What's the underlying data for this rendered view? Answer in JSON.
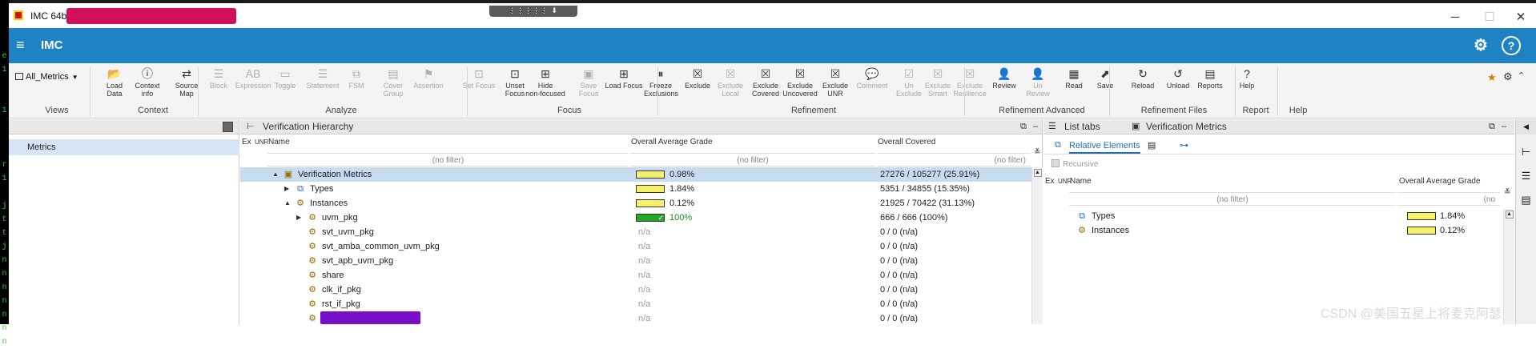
{
  "terminal": {
    "chars": [
      "e",
      "1",
      "",
      "",
      "1",
      "",
      "",
      "",
      "r",
      "1",
      "",
      "j",
      "t",
      "t",
      "j",
      "n",
      "n",
      "n",
      "n",
      "n",
      "n",
      "n"
    ]
  },
  "window": {
    "title": "IMC 64b"
  },
  "app": {
    "name": "IMC",
    "menu_glyph": "≡",
    "settings_glyph": "⚙",
    "help_glyph": "?"
  },
  "window_controls": {
    "minimize": "─",
    "maximize": "☐",
    "close": "✕"
  },
  "grip_label": "⋮⋮⋮⋮⋮ ⬇ ⋮⋮⋮⋮⋮",
  "toolbar": {
    "metrics_combo": "All_Metrics",
    "buttons": [
      {
        "label": "Load\nData",
        "glyph": "📂",
        "enabled": true
      },
      {
        "label": "Context\ninfo",
        "glyph": "ⓘ",
        "enabled": true
      },
      {
        "label": "Source Map",
        "glyph": "⇄",
        "enabled": true
      },
      {
        "label": "Block",
        "glyph": "☰",
        "enabled": false
      },
      {
        "label": "Expression",
        "glyph": "AB",
        "enabled": false
      },
      {
        "label": "Toggle",
        "glyph": "▭",
        "enabled": false
      },
      {
        "label": "Statement",
        "glyph": "☰",
        "enabled": false
      },
      {
        "label": "FSM",
        "glyph": "⧉",
        "enabled": false
      },
      {
        "label": "Cover\nGroup",
        "glyph": "▤",
        "enabled": false
      },
      {
        "label": "Assertion",
        "glyph": "⚑",
        "enabled": false
      },
      {
        "label": "Set Focus",
        "glyph": "⊡",
        "enabled": false
      },
      {
        "label": "Unset\nFocus",
        "glyph": "⊡",
        "enabled": true
      },
      {
        "label": "Hide\nnon-focused",
        "glyph": "⊞",
        "enabled": true
      },
      {
        "label": "Save Focus",
        "glyph": "▣",
        "enabled": false
      },
      {
        "label": "Load Focus",
        "glyph": "⊞",
        "enabled": true
      },
      {
        "label": "Freeze\nExclusions",
        "glyph": "⏸",
        "enabled": true
      },
      {
        "label": "Exclude",
        "glyph": "☒",
        "enabled": true
      },
      {
        "label": "Exclude\nLocal",
        "glyph": "☒",
        "enabled": false
      },
      {
        "label": "Exclude\nCovered",
        "glyph": "☒",
        "enabled": true
      },
      {
        "label": "Exclude\nUncovered",
        "glyph": "☒",
        "enabled": true
      },
      {
        "label": "Exclude\nUNR",
        "glyph": "☒",
        "enabled": true
      },
      {
        "label": "Comment",
        "glyph": "💬",
        "enabled": false
      },
      {
        "label": "Un\nExclude",
        "glyph": "☑",
        "enabled": false
      },
      {
        "label": "Exclude\nSmart",
        "glyph": "☒",
        "enabled": false
      },
      {
        "label": "Exclude\nResilience",
        "glyph": "☒",
        "enabled": false
      },
      {
        "label": "Review",
        "glyph": "👤",
        "enabled": true
      },
      {
        "label": "Un\nReview",
        "glyph": "👤",
        "enabled": false
      },
      {
        "label": "Read",
        "glyph": "▦",
        "enabled": true
      },
      {
        "label": "Save",
        "glyph": "⬈",
        "enabled": true
      },
      {
        "label": "Reload",
        "glyph": "↻",
        "enabled": true
      },
      {
        "label": "Unload",
        "glyph": "↺",
        "enabled": true
      },
      {
        "label": "Reports",
        "glyph": "▤",
        "enabled": true
      },
      {
        "label": "Help",
        "glyph": "?",
        "enabled": true
      }
    ],
    "groups": [
      "Views",
      "Context",
      "Analyze",
      "Focus",
      "Refinement",
      "Refinement Advanced",
      "Refinement Files",
      "Report",
      "Help"
    ]
  },
  "left_pane": {
    "selected_item": "Metrics"
  },
  "hierarchy": {
    "title": "Verification Hierarchy",
    "columns": {
      "ex": "Ex",
      "unr": "UNR",
      "name": "Name",
      "grade": "Overall Average Grade",
      "covered": "Overall Covered"
    },
    "filter_placeholder": "(no filter)",
    "rows": [
      {
        "name": "Verification Metrics",
        "grade": "0.98%",
        "grade_fraction": 0.0098,
        "covered": "27276 / 105277 (25.91%)",
        "indent": 0,
        "expander": "▲",
        "icon": "▣"
      },
      {
        "name": "Types",
        "grade": "1.84%",
        "grade_fraction": 0.0184,
        "covered": "5351 / 34855 (15.35%)",
        "indent": 1,
        "expander": "▶",
        "icon": "⧉"
      },
      {
        "name": "Instances",
        "grade": "0.12%",
        "grade_fraction": 0.0012,
        "covered": "21925 / 70422 (31.13%)",
        "indent": 1,
        "expander": "▲",
        "icon": "⚙"
      },
      {
        "name": "uvm_pkg",
        "grade": "100%",
        "grade_fraction": 1.0,
        "covered": "666 / 666 (100%)",
        "indent": 2,
        "expander": "▶",
        "icon": "⚙"
      },
      {
        "name": "svt_uvm_pkg",
        "grade": "n/a",
        "grade_fraction": null,
        "covered": "0 / 0 (n/a)",
        "indent": 2,
        "expander": "",
        "icon": "⚙"
      },
      {
        "name": "svt_amba_common_uvm_pkg",
        "grade": "n/a",
        "grade_fraction": null,
        "covered": "0 / 0 (n/a)",
        "indent": 2,
        "expander": "",
        "icon": "⚙"
      },
      {
        "name": "svt_apb_uvm_pkg",
        "grade": "n/a",
        "grade_fraction": null,
        "covered": "0 / 0 (n/a)",
        "indent": 2,
        "expander": "",
        "icon": "⚙"
      },
      {
        "name": "share",
        "grade": "n/a",
        "grade_fraction": null,
        "covered": "0 / 0 (n/a)",
        "indent": 2,
        "expander": "",
        "icon": "⚙"
      },
      {
        "name": "clk_if_pkg",
        "grade": "n/a",
        "grade_fraction": null,
        "covered": "0 / 0 (n/a)",
        "indent": 2,
        "expander": "",
        "icon": "⚙"
      },
      {
        "name": "rst_if_pkg",
        "grade": "n/a",
        "grade_fraction": null,
        "covered": "0 / 0 (n/a)",
        "indent": 2,
        "expander": "",
        "icon": "⚙"
      },
      {
        "name": "",
        "grade": "n/a",
        "grade_fraction": null,
        "covered": "0 / 0 (n/a)",
        "indent": 2,
        "expander": "",
        "icon": "⚙"
      }
    ]
  },
  "right_panel": {
    "tabs": [
      "List tabs",
      "Verification Metrics"
    ],
    "subtab": "Relative Elements",
    "recursive_label": "Recursive",
    "columns": {
      "ex": "Ex",
      "unr": "UNR",
      "name": "Name",
      "grade": "Overall Average Grade"
    },
    "filter_placeholder": "(no filter)",
    "filter_placeholder_short": "(no",
    "rows": [
      {
        "name": "Types",
        "grade": "1.84%",
        "icon": "⧉"
      },
      {
        "name": "Instances",
        "grade": "0.12%",
        "icon": "⚙"
      }
    ]
  },
  "watermark": "CSDN @美国五星上将麦克阿瑟"
}
